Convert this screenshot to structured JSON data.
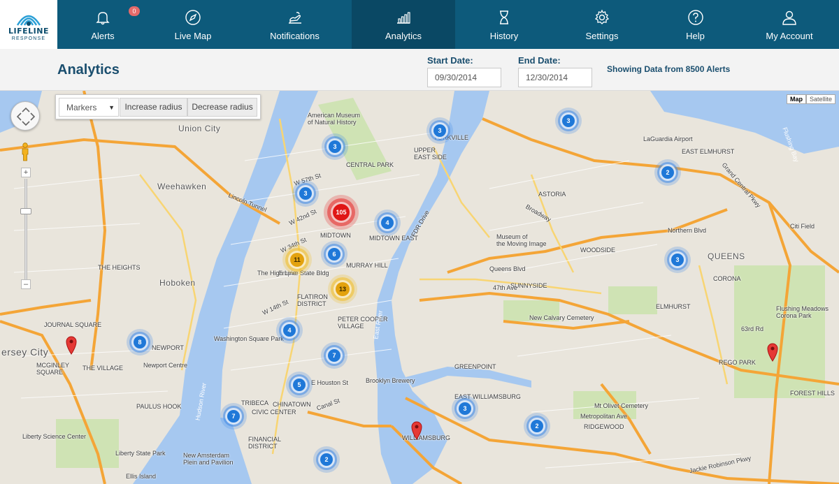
{
  "brand": {
    "line1": "LIFELINE",
    "line2": "RESPONSE"
  },
  "nav": {
    "items": [
      {
        "label": "Alerts",
        "icon": "bell-icon",
        "badge": "0"
      },
      {
        "label": "Live Map",
        "icon": "compass-icon"
      },
      {
        "label": "Notifications",
        "icon": "notification-hand-icon"
      },
      {
        "label": "Analytics",
        "icon": "bar-chart-icon",
        "active": true
      },
      {
        "label": "History",
        "icon": "hourglass-icon"
      },
      {
        "label": "Settings",
        "icon": "gear-icon"
      },
      {
        "label": "Help",
        "icon": "question-icon"
      },
      {
        "label": "My Account",
        "icon": "user-icon"
      }
    ]
  },
  "page": {
    "title": "Analytics",
    "start_date_label": "Start Date:",
    "start_date": "09/30/2014",
    "end_date_label": "End Date:",
    "end_date": "12/30/2014",
    "summary": "Showing Data from 8500 Alerts"
  },
  "map_controls": {
    "layer_select": "Markers",
    "increase_radius": "Increase radius",
    "decrease_radius": "Decrease radius",
    "map_type_map": "Map",
    "map_type_satellite": "Satellite",
    "zoom_in": "+",
    "zoom_out": "–"
  },
  "colors": {
    "nav_bg": "#0d5a7b",
    "nav_active": "#0a4864",
    "cluster_blue": "#1f78d8",
    "cluster_yellow": "#e3a20e",
    "cluster_red": "#e01616",
    "water": "#a6c8f0",
    "highway": "#f4a537"
  },
  "clusters": [
    {
      "count": "3",
      "level": "blue"
    },
    {
      "count": "3",
      "level": "blue"
    },
    {
      "count": "3",
      "level": "blue"
    },
    {
      "count": "3",
      "level": "blue"
    },
    {
      "count": "105",
      "level": "red"
    },
    {
      "count": "4",
      "level": "blue"
    },
    {
      "count": "6",
      "level": "blue"
    },
    {
      "count": "11",
      "level": "yellow"
    },
    {
      "count": "13",
      "level": "yellow"
    },
    {
      "count": "4",
      "level": "blue"
    },
    {
      "count": "7",
      "level": "blue"
    },
    {
      "count": "5",
      "level": "blue"
    },
    {
      "count": "7",
      "level": "blue"
    },
    {
      "count": "8",
      "level": "blue"
    },
    {
      "count": "3",
      "level": "blue"
    },
    {
      "count": "2",
      "level": "blue"
    },
    {
      "count": "2",
      "level": "blue"
    },
    {
      "count": "2",
      "level": "blue"
    },
    {
      "count": "3",
      "level": "blue"
    }
  ],
  "map_labels": {
    "union_city": "Union City",
    "weehawken": "Weehawken",
    "hoboken": "Hoboken",
    "jersey_city": "ersey City",
    "queens": "QUEENS",
    "astoria": "ASTORIA",
    "laguardia": "LaGuardia Airport",
    "east_elmhurst": "EAST ELMHURST",
    "citi_field": "Citi Field",
    "woodside": "WOODSIDE",
    "sunnyside": "SUNNYSIDE",
    "museum": "Museum of\nthe Moving Image",
    "elmhurst": "ELMHURST",
    "corona": "CORONA",
    "flushing_meadows": "Flushing Meadows\nCorona Park",
    "new_calvary": "New Calvary Cemetery",
    "greenpoint": "GREENPOINT",
    "brooklyn_brewery": "Brooklyn Brewery",
    "williamsburg": "WILLIAMSBURG",
    "east_williamsburg": "EAST WILLIAMSBURG",
    "mt_olivet": "Mt Olivet Cemetery",
    "ridgewood": "RIDGEWOOD",
    "rego_park": "REGO PARK",
    "forest_hills": "FOREST HILLS",
    "american_museum": "American Museum\nof Natural History",
    "central_park": "CENTRAL PARK",
    "yorkville": "YORKVILLE",
    "upper_east": "UPPER\nEAST SIDE",
    "midtown": "MIDTOWN",
    "midtown_east": "MIDTOWN EAST",
    "murray_hill": "MURRAY HILL",
    "empire_state": "Empire State Bldg",
    "high_line": "The High Line",
    "flatiron": "FLATIRON\nDISTRICT",
    "washington_sq": "Washington Square Park",
    "peter_cooper": "PETER COOPER\nVILLAGE",
    "tribeca": "TRIBECA",
    "chinatown": "CHINATOWN",
    "civic_center": "CIVIC CENTER",
    "financial": "FINANCIAL\nDISTRICT",
    "newport": "NEWPORT",
    "newport_centre": "Newport Centre",
    "the_heights": "THE HEIGHTS",
    "journal_square": "JOURNAL SQUARE",
    "the_village": "THE VILLAGE",
    "mcginley": "MCGINLEY\nSQUARE",
    "paulus_hook": "PAULUS HOOK",
    "liberty_science": "Liberty Science Center",
    "liberty_state": "Liberty State Park",
    "ellis_island": "Ellis Island",
    "new_amsterdam": "New Amsterdam\nPlein and Pavilion",
    "lincoln_tunnel": "Lincoln Tunnel",
    "fdr_drive": "FDR Drive",
    "east_river": "East River",
    "hudson_river": "Hudson River",
    "flushing_bay": "Flushing Bay",
    "grand_central_pkwy": "Grand Central Pkwy",
    "northern_blvd": "Northern Blvd",
    "broadway": "Broadway",
    "queens_blvd": "Queens Blvd",
    "metropolitan_ave": "Metropolitan Ave",
    "jackie_robinson": "Jackie Robinson Pkwy",
    "w_57th": "W 57th St",
    "w_42nd": "W 42nd St",
    "w_34th": "W 34th St",
    "w_14th": "W 14th St",
    "houston": "E Houston St",
    "canal": "Canal St",
    "47th_ave": "47th Ave",
    "63rd_rd": "63rd Rd"
  }
}
